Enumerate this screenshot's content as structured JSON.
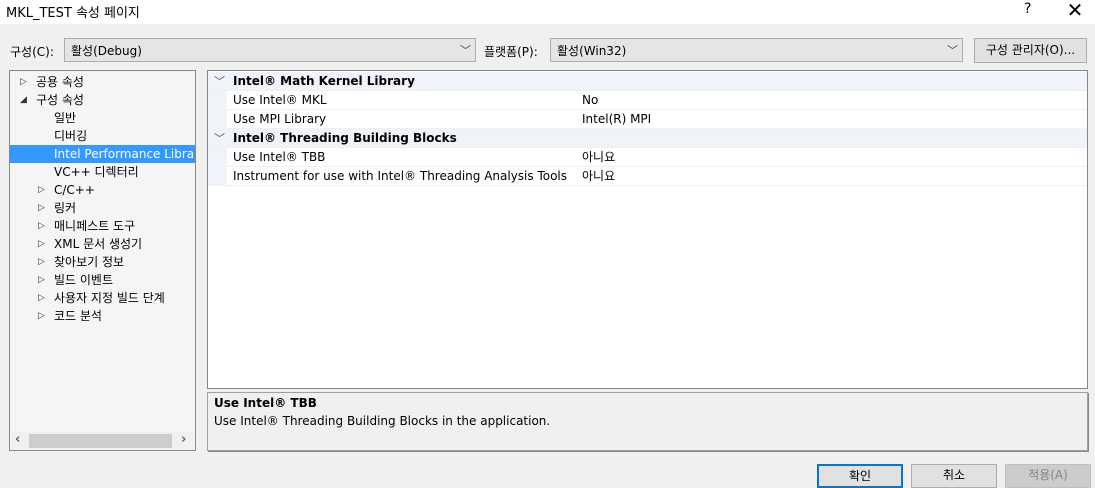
{
  "window": {
    "title": "MKL_TEST 속성 페이지",
    "help": "?",
    "close": "✕"
  },
  "toolbar": {
    "config_label": "구성(C):",
    "config_value": "활성(Debug)",
    "platform_label": "플랫폼(P):",
    "platform_value": "활성(Win32)",
    "config_manager": "구성 관리자(O)..."
  },
  "tree": [
    {
      "label": "공용 속성",
      "level": 0,
      "toggle": "▷"
    },
    {
      "label": "구성 속성",
      "level": 0,
      "toggle": "◢"
    },
    {
      "label": "일반",
      "level": 1,
      "toggle": ""
    },
    {
      "label": "디버깅",
      "level": 1,
      "toggle": ""
    },
    {
      "label": "Intel Performance Libraries",
      "level": 1,
      "toggle": "",
      "selected": true
    },
    {
      "label": "VC++ 디렉터리",
      "level": 1,
      "toggle": ""
    },
    {
      "label": "C/C++",
      "level": 1,
      "toggle": "▷"
    },
    {
      "label": "링커",
      "level": 1,
      "toggle": "▷"
    },
    {
      "label": "매니페스트 도구",
      "level": 1,
      "toggle": "▷"
    },
    {
      "label": "XML 문서 생성기",
      "level": 1,
      "toggle": "▷"
    },
    {
      "label": "찾아보기 정보",
      "level": 1,
      "toggle": "▷"
    },
    {
      "label": "빌드 이벤트",
      "level": 1,
      "toggle": "▷"
    },
    {
      "label": "사용자 지정 빌드 단계",
      "level": 1,
      "toggle": "▷"
    },
    {
      "label": "코드 분석",
      "level": 1,
      "toggle": "▷"
    }
  ],
  "grid": [
    {
      "type": "category",
      "name": "Intel® Math Kernel Library"
    },
    {
      "type": "prop",
      "name": "Use Intel® MKL",
      "value": "No"
    },
    {
      "type": "prop",
      "name": "Use MPI Library",
      "value": "Intel(R) MPI"
    },
    {
      "type": "category",
      "name": "Intel® Threading Building Blocks"
    },
    {
      "type": "prop",
      "name": "Use Intel® TBB",
      "value": "아니요"
    },
    {
      "type": "prop",
      "name": "Instrument for use with Intel® Threading Analysis Tools",
      "value": "아니요"
    }
  ],
  "description": {
    "title": "Use Intel® TBB",
    "text": "Use Intel® Threading Building Blocks in the application."
  },
  "buttons": {
    "ok": "확인",
    "cancel": "취소",
    "apply": "적용(A)"
  }
}
